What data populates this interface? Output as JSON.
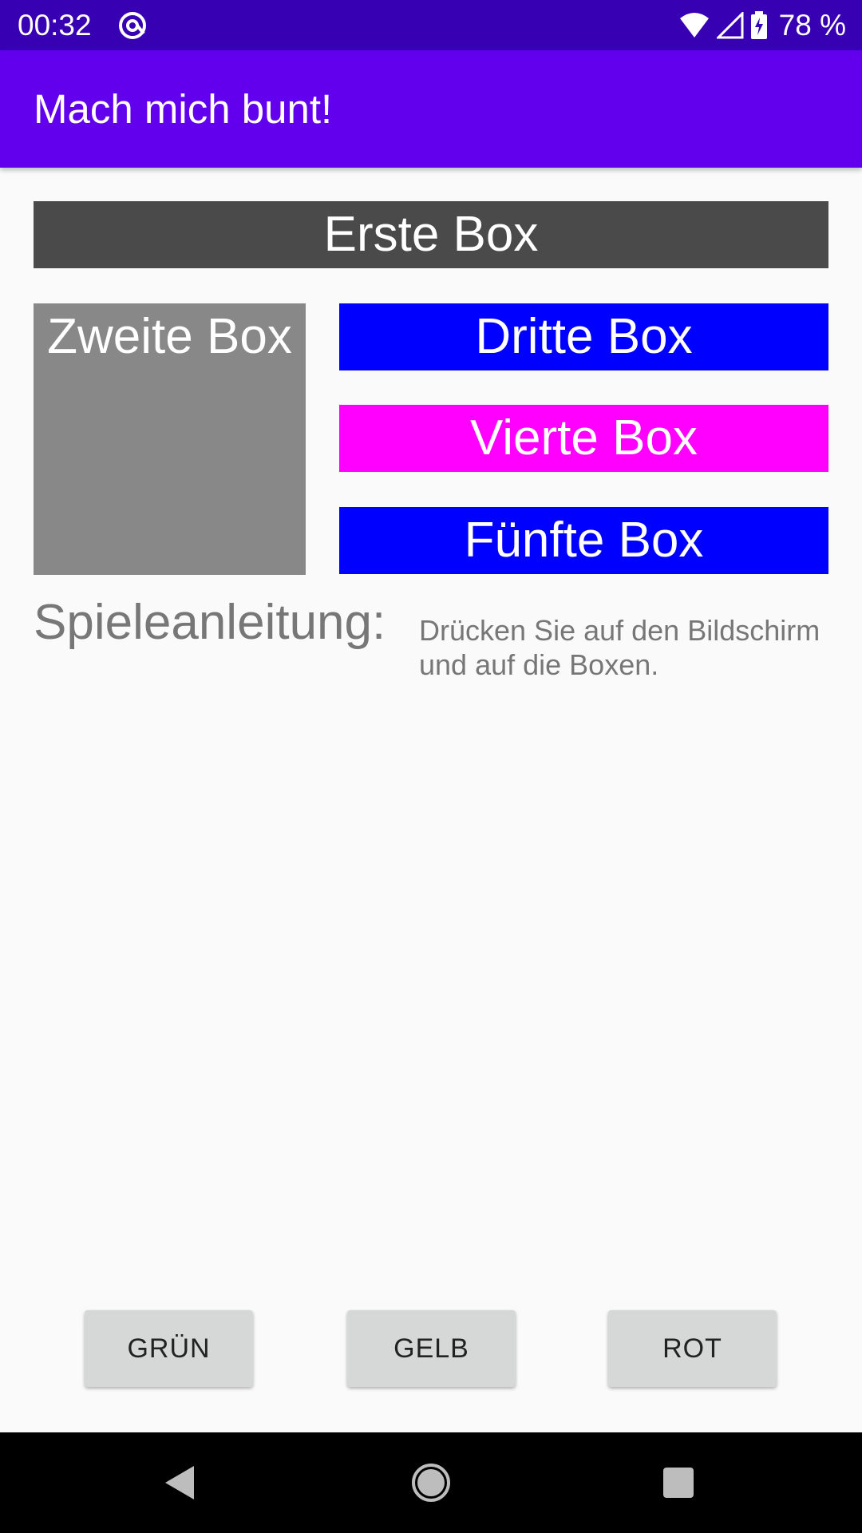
{
  "status_bar": {
    "time": "00:32",
    "battery_text": "78 %",
    "icons": [
      "at-sign-icon",
      "wifi-icon",
      "signal-icon",
      "battery-charging-icon"
    ]
  },
  "app_bar": {
    "title": "Mach mich bunt!"
  },
  "boxes": [
    {
      "label": "Erste Box",
      "color": "#4a4a4a"
    },
    {
      "label": "Zweite Box",
      "color": "#888888"
    },
    {
      "label": "Dritte Box",
      "color": "#0000ff"
    },
    {
      "label": "Vierte Box",
      "color": "#ff00ff"
    },
    {
      "label": "Fünfte Box",
      "color": "#0000ff"
    }
  ],
  "instructions": {
    "heading": "Spieleanleitung:",
    "text": "Drücken Sie auf den Bildschirm und auf die Boxen."
  },
  "buttons": [
    {
      "label": "GRÜN"
    },
    {
      "label": "GELB"
    },
    {
      "label": "ROT"
    }
  ],
  "nav_bar": {
    "icons": [
      "back-icon",
      "home-icon",
      "recent-apps-icon"
    ]
  },
  "colors": {
    "status_bar": "#3700b3",
    "app_bar": "#6200ee",
    "background": "#fafafa"
  }
}
